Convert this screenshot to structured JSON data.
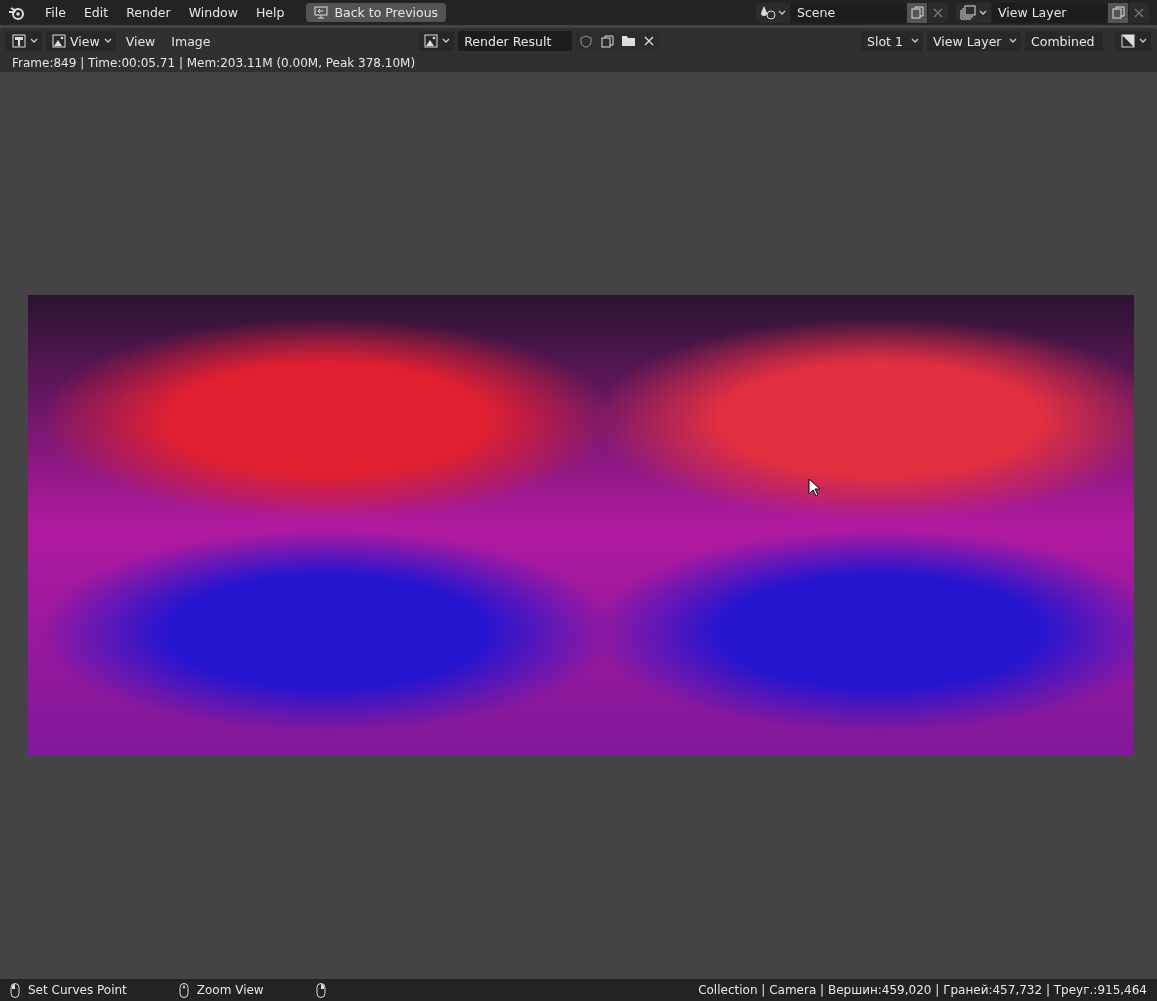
{
  "topbar": {
    "menus": [
      "File",
      "Edit",
      "Render",
      "Window",
      "Help"
    ],
    "back_button": "Back to Previous",
    "scene": "Scene",
    "view_layer": "View Layer"
  },
  "header": {
    "mode": "View",
    "menus": [
      "View",
      "Image"
    ],
    "image": "Render Result",
    "slot": "Slot 1",
    "layer": "View Layer",
    "pass": "Combined"
  },
  "info": "Frame:849 | Time:00:05.71 | Mem:203.11M (0.00M, Peak 378.10M)",
  "status_bar": {
    "hints": [
      {
        "kind": "left",
        "label": "Set Curves Point"
      },
      {
        "kind": "middle",
        "label": "Zoom View"
      },
      {
        "kind": "right"
      }
    ],
    "stats": "Collection | Camera | Вершин:459,020 | Граней:457,732 | Треуг.:915,464"
  }
}
